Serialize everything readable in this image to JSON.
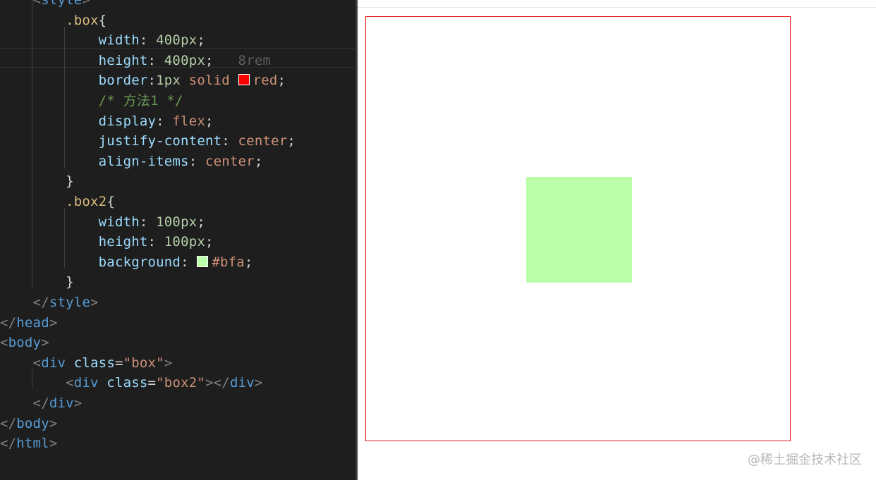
{
  "editor": {
    "lines": [
      {
        "parts": [
          [
            "t-punc",
            "    <"
          ],
          [
            "t-tag",
            "style"
          ],
          [
            "t-punc",
            ">"
          ]
        ]
      },
      {
        "parts": [
          [
            "t-sel",
            "        .box"
          ],
          [
            "t-plain",
            "{"
          ]
        ]
      },
      {
        "parts": [
          [
            "t-prop",
            "            width"
          ],
          [
            "t-plain",
            ": "
          ],
          [
            "t-num",
            "400px"
          ],
          [
            "t-plain",
            ";"
          ]
        ]
      },
      {
        "parts": [
          [
            "t-prop",
            "            height"
          ],
          [
            "t-plain",
            ": "
          ],
          [
            "t-num",
            "400px"
          ],
          [
            "t-plain",
            ";"
          ],
          [
            "t-hint",
            "   8rem"
          ]
        ]
      },
      {
        "parts": [
          [
            "t-prop",
            "            border"
          ],
          [
            "t-plain",
            ":"
          ],
          [
            "t-num",
            "1px"
          ],
          [
            "t-val",
            " solid "
          ],
          [
            "swatch",
            "#ff0000"
          ],
          [
            "t-val",
            "red"
          ],
          [
            "t-plain",
            ";"
          ]
        ]
      },
      {
        "parts": [
          [
            "t-comment",
            "            /* 方法1 */"
          ]
        ]
      },
      {
        "parts": [
          [
            "t-prop",
            "            display"
          ],
          [
            "t-plain",
            ": "
          ],
          [
            "t-val",
            "flex"
          ],
          [
            "t-plain",
            ";"
          ]
        ]
      },
      {
        "parts": [
          [
            "t-prop",
            "            justify-content"
          ],
          [
            "t-plain",
            ": "
          ],
          [
            "t-val",
            "center"
          ],
          [
            "t-plain",
            ";"
          ]
        ]
      },
      {
        "parts": [
          [
            "t-prop",
            "            align-items"
          ],
          [
            "t-plain",
            ": "
          ],
          [
            "t-val",
            "center"
          ],
          [
            "t-plain",
            ";"
          ]
        ]
      },
      {
        "parts": [
          [
            "t-plain",
            "        }"
          ]
        ]
      },
      {
        "parts": [
          [
            "t-sel",
            "        .box2"
          ],
          [
            "t-plain",
            "{"
          ]
        ]
      },
      {
        "parts": [
          [
            "t-prop",
            "            width"
          ],
          [
            "t-plain",
            ": "
          ],
          [
            "t-num",
            "100px"
          ],
          [
            "t-plain",
            ";"
          ]
        ]
      },
      {
        "parts": [
          [
            "t-prop",
            "            height"
          ],
          [
            "t-plain",
            ": "
          ],
          [
            "t-num",
            "100px"
          ],
          [
            "t-plain",
            ";"
          ]
        ]
      },
      {
        "parts": [
          [
            "t-prop",
            "            background"
          ],
          [
            "t-plain",
            ": "
          ],
          [
            "swatch",
            "#bbffaa"
          ],
          [
            "t-val",
            "#bfa"
          ],
          [
            "t-plain",
            ";"
          ]
        ]
      },
      {
        "parts": [
          [
            "t-plain",
            "        }"
          ]
        ]
      },
      {
        "parts": [
          [
            "t-punc",
            "    </"
          ],
          [
            "t-tag",
            "style"
          ],
          [
            "t-punc",
            ">"
          ]
        ]
      },
      {
        "parts": [
          [
            "t-punc",
            "</"
          ],
          [
            "t-tag",
            "head"
          ],
          [
            "t-punc",
            ">"
          ]
        ]
      },
      {
        "parts": [
          [
            "t-punc",
            "<"
          ],
          [
            "t-tag",
            "body"
          ],
          [
            "t-punc",
            ">"
          ]
        ]
      },
      {
        "parts": [
          [
            "t-punc",
            "    <"
          ],
          [
            "t-tag",
            "div"
          ],
          [
            "t-attr",
            " class"
          ],
          [
            "t-plain",
            "="
          ],
          [
            "t-str",
            "\"box\""
          ],
          [
            "t-punc",
            ">"
          ]
        ]
      },
      {
        "parts": [
          [
            "t-punc",
            "        <"
          ],
          [
            "t-tag",
            "div"
          ],
          [
            "t-attr",
            " class"
          ],
          [
            "t-plain",
            "="
          ],
          [
            "t-str",
            "\"box2\""
          ],
          [
            "t-punc",
            "></"
          ],
          [
            "t-tag",
            "div"
          ],
          [
            "t-punc",
            ">"
          ]
        ]
      },
      {
        "parts": [
          [
            "t-punc",
            "    </"
          ],
          [
            "t-tag",
            "div"
          ],
          [
            "t-punc",
            ">"
          ]
        ]
      },
      {
        "parts": [
          [
            "t-punc",
            "</"
          ],
          [
            "t-tag",
            "body"
          ],
          [
            "t-punc",
            ">"
          ]
        ]
      },
      {
        "parts": [
          [
            "t-punc",
            "</"
          ],
          [
            "t-tag",
            "html"
          ],
          [
            "t-punc",
            ">"
          ]
        ]
      }
    ]
  },
  "preview": {
    "box": {
      "border_color": "#ff0000"
    },
    "box2": {
      "background": "#bbffaa"
    }
  },
  "watermark": "@稀土掘金技术社区"
}
